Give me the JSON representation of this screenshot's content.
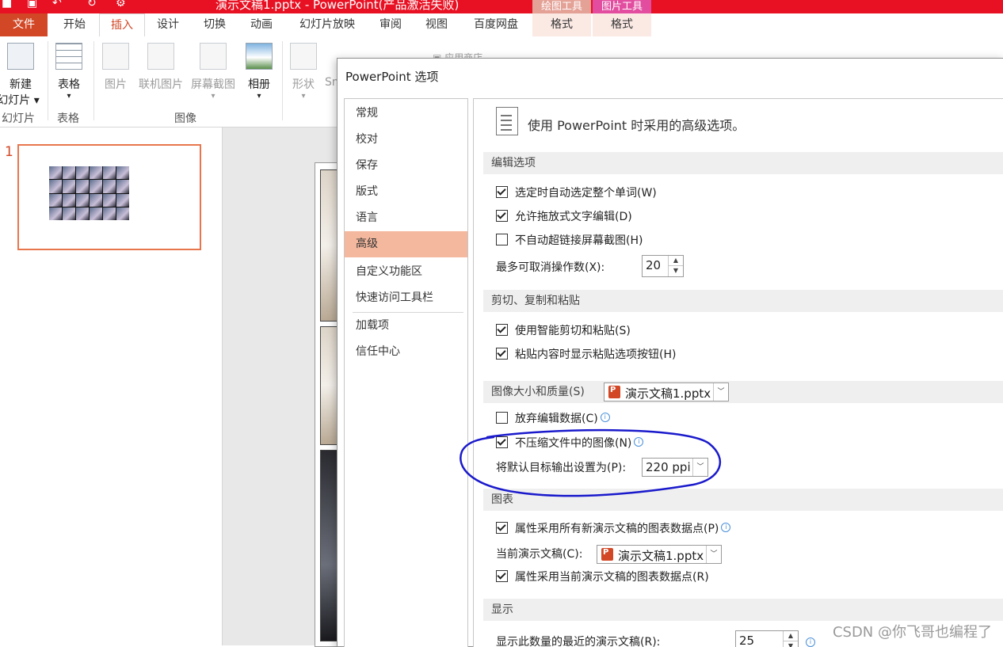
{
  "window": {
    "title": "演示文稿1.pptx -  PowerPoint(产品激活失败)",
    "context_headers": [
      "绘图工具",
      "图片工具"
    ],
    "accent": "#e81123"
  },
  "ribbon": {
    "tabs": [
      "文件",
      "开始",
      "插入",
      "设计",
      "切换",
      "动画",
      "幻灯片放映",
      "审阅",
      "视图",
      "百度网盘",
      "格式",
      "格式"
    ],
    "active_tab": "插入",
    "buttons": {
      "new_slide": "新建\n幻灯片",
      "new_slide_l1": "新建",
      "new_slide_l2": "幻灯片",
      "table": "表格",
      "picture": "图片",
      "online_picture": "联机图片",
      "screenshot": "屏幕截图",
      "album": "相册",
      "shapes": "形状",
      "smartart_partial": "Sm",
      "app_store_partial": "应用商店"
    },
    "groups": {
      "slides": "幻灯片",
      "tables": "表格",
      "images": "图像"
    }
  },
  "slides_pane": {
    "slide_number": "1"
  },
  "dialog": {
    "title": "PowerPoint 选项",
    "nav": [
      "常规",
      "校对",
      "保存",
      "版式",
      "语言",
      "高级",
      "自定义功能区",
      "快速访问工具栏",
      "加载项",
      "信任中心"
    ],
    "selected_nav": "高级",
    "header": "使用 PowerPoint 时采用的高级选项。",
    "sections": {
      "edit": {
        "title": "编辑选项",
        "opt1": "选定时自动选定整个单词(W)",
        "opt1_checked": true,
        "opt2": "允许拖放式文字编辑(D)",
        "opt2_checked": true,
        "opt3": "不自动超链接屏幕截图(H)",
        "opt3_checked": false,
        "undo_label": "最多可取消操作数(X):",
        "undo_value": "20"
      },
      "clipboard": {
        "title": "剪切、复制和粘贴",
        "opt1": "使用智能剪切和粘贴(S)",
        "opt1_checked": true,
        "opt2": "粘贴内容时显示粘贴选项按钮(H)",
        "opt2_checked": true
      },
      "image": {
        "title": "图像大小和质量(S)",
        "file": "演示文稿1.pptx",
        "opt1": "放弃编辑数据(C)",
        "opt1_checked": false,
        "opt2": "不压缩文件中的图像(N)",
        "opt2_checked": true,
        "output_label": "将默认目标输出设置为(P):",
        "output_value": "220 ppi"
      },
      "chart": {
        "title": "图表",
        "opt1": "属性采用所有新演示文稿的图表数据点(P)",
        "opt1_checked": true,
        "current_label": "当前演示文稿(C):",
        "current_file": "演示文稿1.pptx",
        "opt2": "属性采用当前演示文稿的图表数据点(R)",
        "opt2_checked": true
      },
      "display": {
        "title": "显示",
        "recent_label": "显示此数量的最近的演示文稿(R):",
        "recent_value": "25"
      }
    }
  },
  "watermark": "CSDN @你飞哥也编程了",
  "annotation_color": "#1a1acc"
}
